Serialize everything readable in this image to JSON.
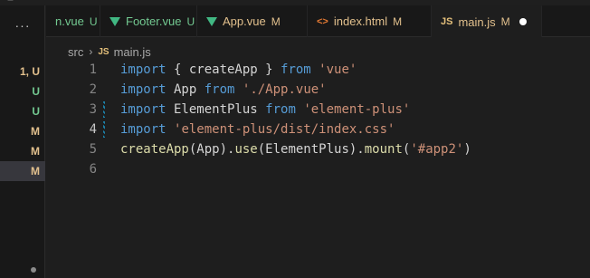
{
  "colors": {
    "status_modified": "#e2c08d",
    "status_untracked": "#73c991",
    "status_conflict": "#e2c08d",
    "vue_green": "#41b883",
    "html_orange": "#e37933",
    "js_yellow": "#e5c07b"
  },
  "gutter": {
    "more_label": "···",
    "statuses": [
      "1, U",
      "U",
      "U",
      "M",
      "M",
      "M"
    ]
  },
  "tabs": [
    {
      "icon": "vue-icon",
      "name": "n.vue",
      "badge": "U",
      "active": false
    },
    {
      "icon": "vue-icon",
      "name": "Footer.vue",
      "badge": "U",
      "active": false
    },
    {
      "icon": "vue-icon",
      "name": "App.vue",
      "badge": "M",
      "active": false
    },
    {
      "icon": "html-icon",
      "name": "index.html",
      "badge": "M",
      "active": false
    },
    {
      "icon": "js-icon",
      "name": "main.js",
      "badge": "M",
      "active": true
    }
  ],
  "breadcrumb": {
    "folder": "src",
    "file_icon": "JS",
    "file": "main.js"
  },
  "editor": {
    "lines": [
      {
        "num": "1",
        "tokens": [
          [
            "kw",
            "import"
          ],
          [
            "plain",
            " { createApp } "
          ],
          [
            "kw",
            "from"
          ],
          [
            "plain",
            " "
          ],
          [
            "str",
            "'vue'"
          ]
        ]
      },
      {
        "num": "2",
        "tokens": [
          [
            "kw",
            "import"
          ],
          [
            "plain",
            " App "
          ],
          [
            "kw",
            "from"
          ],
          [
            "plain",
            " "
          ],
          [
            "str",
            "'./App.vue'"
          ]
        ]
      },
      {
        "num": "3",
        "tokens": [
          [
            "kw",
            "import"
          ],
          [
            "plain",
            " ElementPlus "
          ],
          [
            "kw",
            "from"
          ],
          [
            "plain",
            " "
          ],
          [
            "str",
            "'element-plus'"
          ]
        ]
      },
      {
        "num": "4",
        "tokens": [
          [
            "kw",
            "import"
          ],
          [
            "plain",
            " "
          ],
          [
            "str",
            "'element-plus/dist/index.css'"
          ]
        ]
      },
      {
        "num": "5",
        "tokens": [
          [
            "fn",
            "createApp"
          ],
          [
            "plain",
            "(App)."
          ],
          [
            "fn",
            "use"
          ],
          [
            "plain",
            "(ElementPlus)."
          ],
          [
            "fn",
            "mount"
          ],
          [
            "plain",
            "("
          ],
          [
            "str",
            "'#app2'"
          ],
          [
            "plain",
            ")"
          ]
        ]
      },
      {
        "num": "6",
        "tokens": []
      }
    ],
    "current_line": "4",
    "modified_lines": [
      "3",
      "4"
    ]
  }
}
